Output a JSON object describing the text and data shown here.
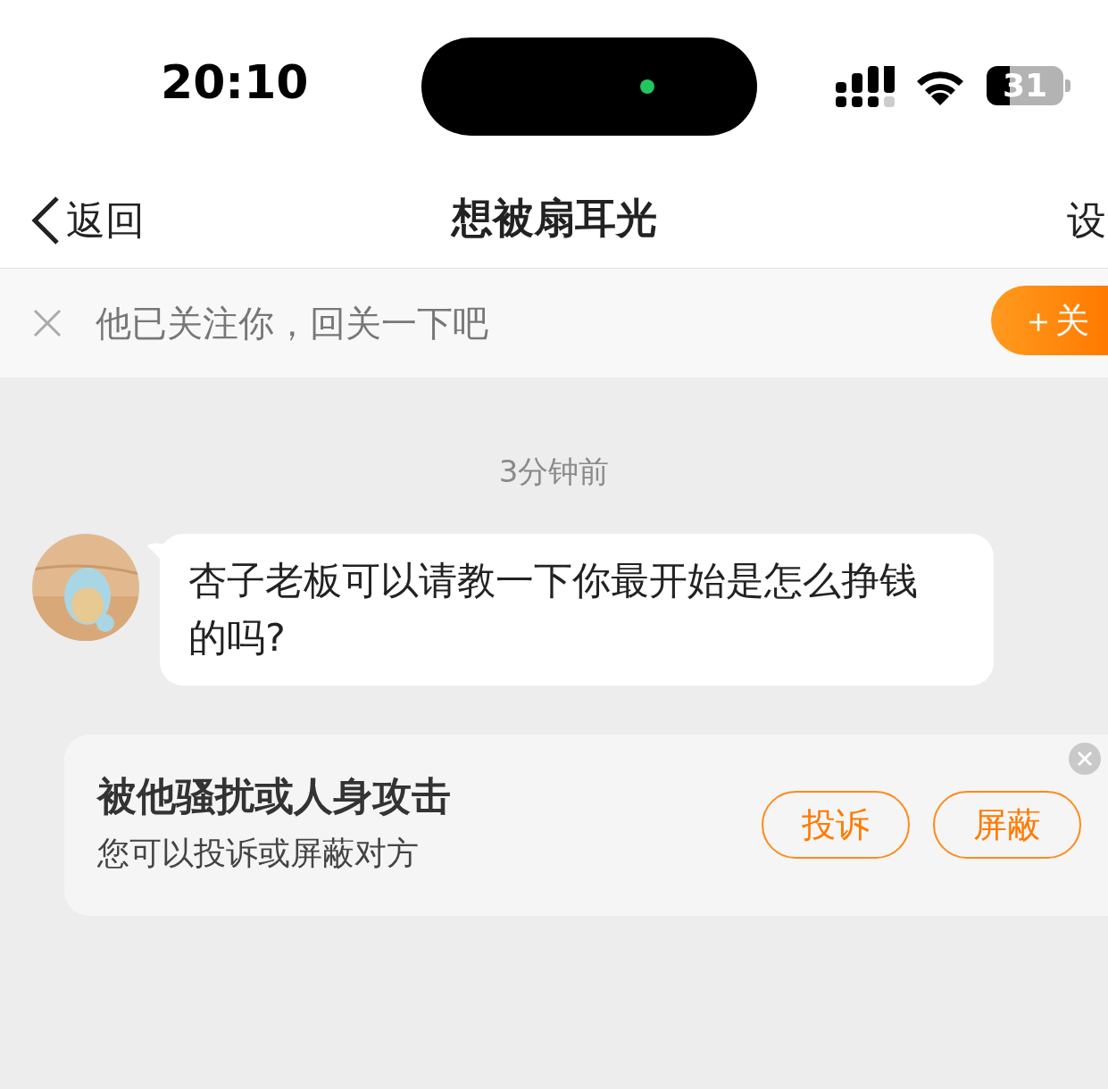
{
  "status_bar": {
    "time": "20:10",
    "battery": "31"
  },
  "nav": {
    "back": "返回",
    "title": "想被扇耳光",
    "right": "设"
  },
  "follow_bar": {
    "text": "他已关注你，回关一下吧",
    "button": "＋关"
  },
  "messages": [
    {
      "kind": "timestamp",
      "text": "3分钟前"
    },
    {
      "kind": "incoming",
      "text": "杏子老板可以请教一下你最开始是怎么挣钱的吗?"
    }
  ],
  "report_card": {
    "title": "被他骚扰或人身攻击",
    "subtitle": "您可以投诉或屏蔽对方",
    "buttons": [
      "投诉",
      "屏蔽"
    ]
  }
}
